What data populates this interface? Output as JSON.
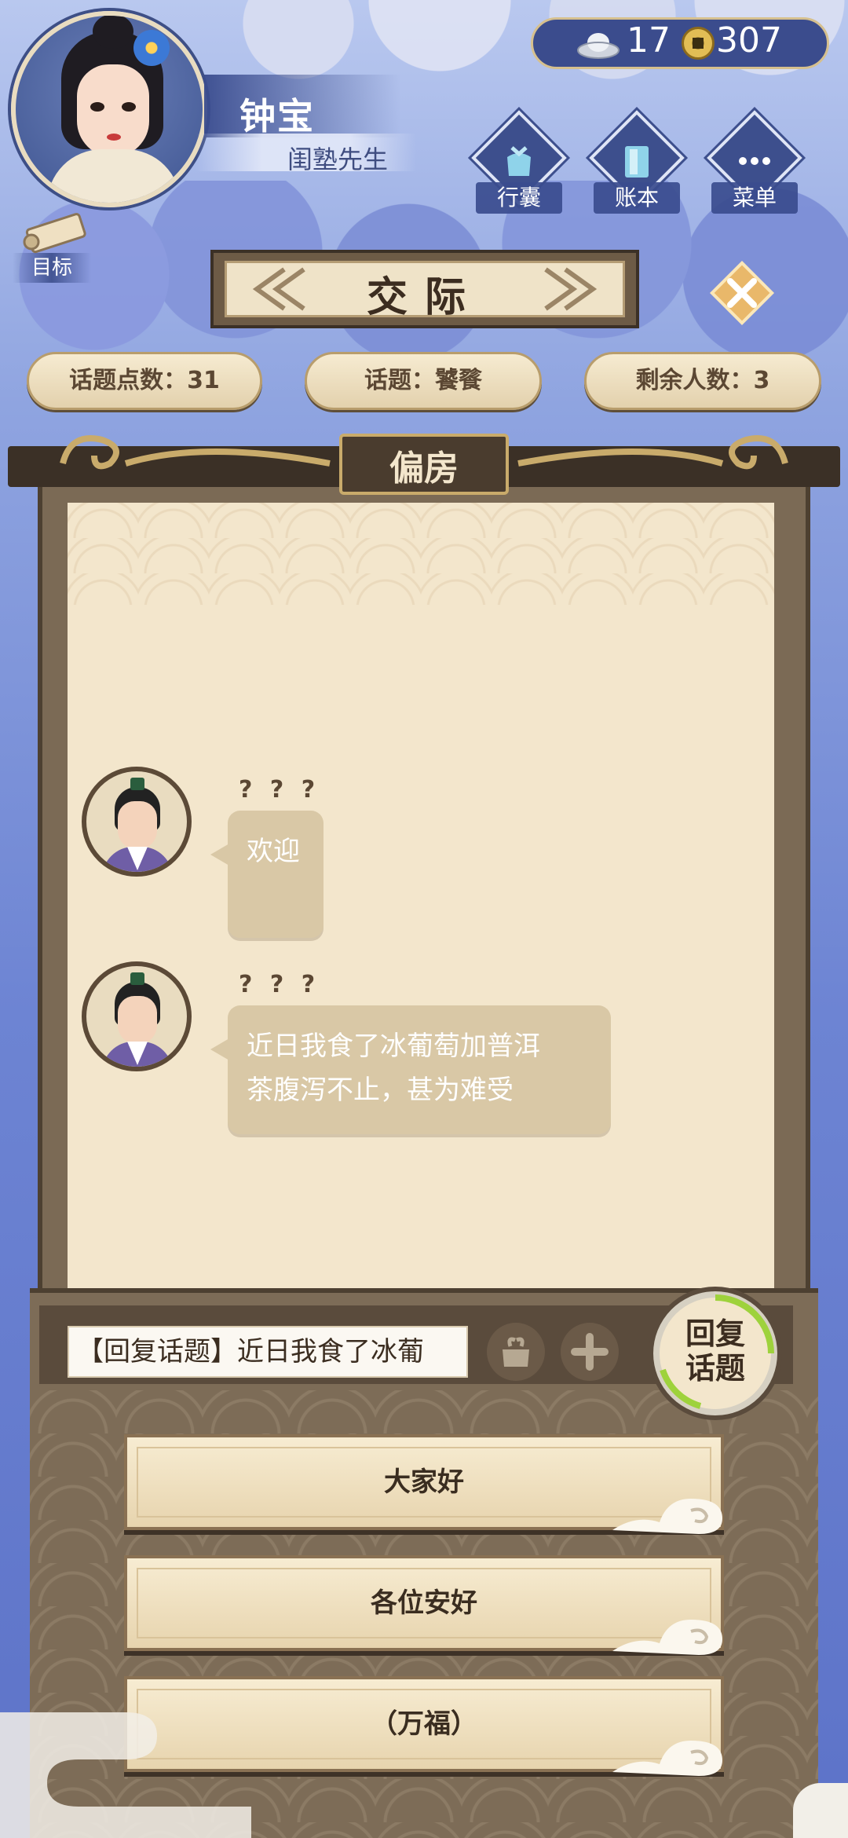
{
  "player": {
    "name": "钟宝",
    "title": "闺塾先生"
  },
  "currency": {
    "silver": "17",
    "gold": "307"
  },
  "menu": {
    "bag_label": "行囊",
    "ledger_label": "账本",
    "menu_label": "菜单",
    "goal_label": "目标"
  },
  "screen": {
    "title": "交际"
  },
  "stats": {
    "topic_points": "话题点数：31",
    "topic": "话题：饕餮",
    "remaining": "剩余人数：3"
  },
  "room": {
    "name": "偏房"
  },
  "chat": [
    {
      "speaker": "? ? ?",
      "text": "欢迎"
    },
    {
      "speaker": "? ? ?",
      "text_line1": "近日我食了冰葡萄加普洱",
      "text_line2": "茶腹泻不止，甚为难受"
    }
  ],
  "reply": {
    "input_value": "【回复话题】近日我食了冰葡",
    "button_line1": "回复",
    "button_line2": "话题"
  },
  "options": [
    "大家好",
    "各位安好",
    "（万福）"
  ],
  "colors": {
    "panel": "#7b6a55",
    "paper": "#f3e6cc",
    "bubble": "#d9c8a6",
    "accent": "#3b4c8d"
  }
}
